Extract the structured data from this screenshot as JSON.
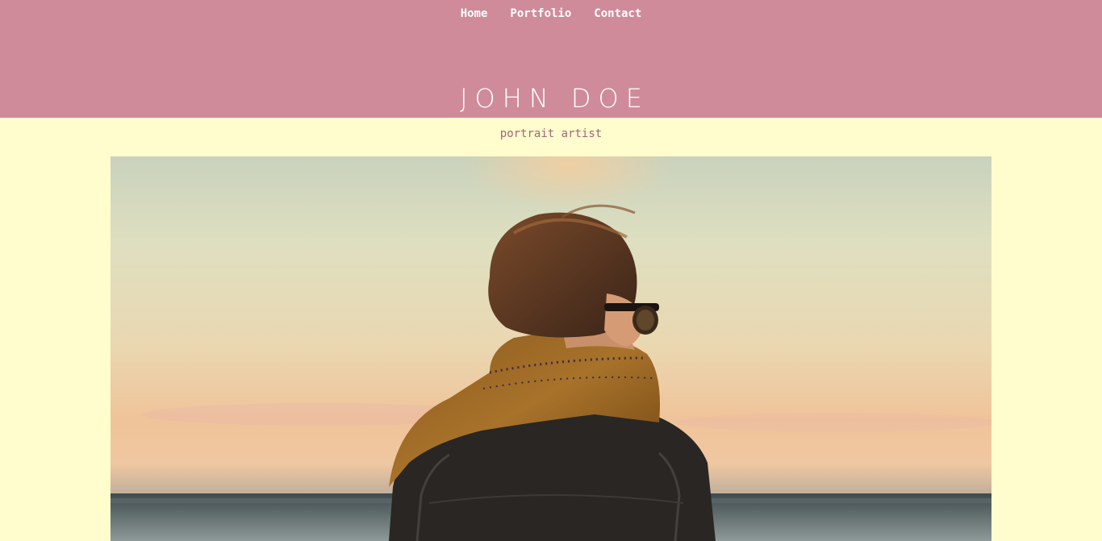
{
  "nav": {
    "items": [
      "Home",
      "Portfolio",
      "Contact"
    ]
  },
  "site": {
    "title": "JOHN DOE",
    "tagline": "portrait artist"
  },
  "hero": {
    "image": "person-in-scarf-seaside-photo"
  },
  "colors": {
    "header_bg": "#cf8b9a",
    "page_bg": "#fffccd",
    "tagline": "#a2677b",
    "nav_text": "#ffffff"
  }
}
